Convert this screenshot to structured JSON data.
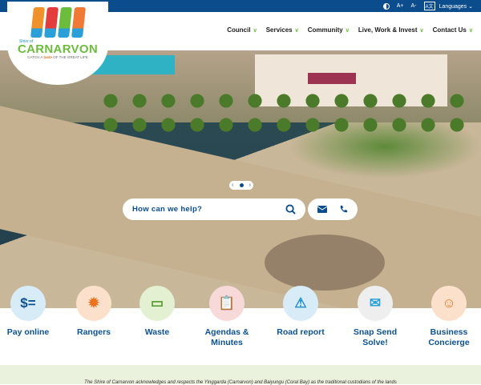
{
  "topbar": {
    "contrast": "contrast-icon",
    "font_increase": "A+",
    "font_decrease": "A-",
    "languages_icon": "A文",
    "languages": "Languages"
  },
  "brand": {
    "shire": "Shire of",
    "name": "CARNARVON",
    "tag_pre": "CATCH A",
    "tag_mid": "taste",
    "tag_post": "OF THE GREAT LIFE"
  },
  "nav": [
    {
      "label": "Council"
    },
    {
      "label": "Services"
    },
    {
      "label": "Community"
    },
    {
      "label": "Live, Work & Invest"
    },
    {
      "label": "Contact Us"
    }
  ],
  "hero": {
    "search_placeholder": "How can we help?",
    "prev": "‹",
    "next": "›"
  },
  "quick_links": [
    {
      "label": "Pay online",
      "icon": "$=",
      "color": "#d8ecf8",
      "ic": "#0d5191"
    },
    {
      "label": "Rangers",
      "icon": "✹",
      "color": "#fbe1cc",
      "ic": "#e9731e"
    },
    {
      "label": "Waste",
      "icon": "▭",
      "color": "#e3f0d2",
      "ic": "#4e9a2a"
    },
    {
      "label": "Agendas & Minutes",
      "icon": "📋",
      "color": "#f8d9d9",
      "ic": "#d93b3b"
    },
    {
      "label": "Road report",
      "icon": "⚠",
      "color": "#d8ecf8",
      "ic": "#1e8fc9"
    },
    {
      "label": "Snap Send Solve!",
      "icon": "✉",
      "color": "#eeeeee",
      "ic": "#2a9fd8"
    },
    {
      "label": "Business Concierge",
      "icon": "☺",
      "color": "#fbe1cc",
      "ic": "#e9731e"
    }
  ],
  "acknowledgement": "The Shire of Carnarvon acknowledges and respects the Yinggarda (Carnarvon) and Baiyungu (Coral Bay) as the traditional custodians of the lands"
}
